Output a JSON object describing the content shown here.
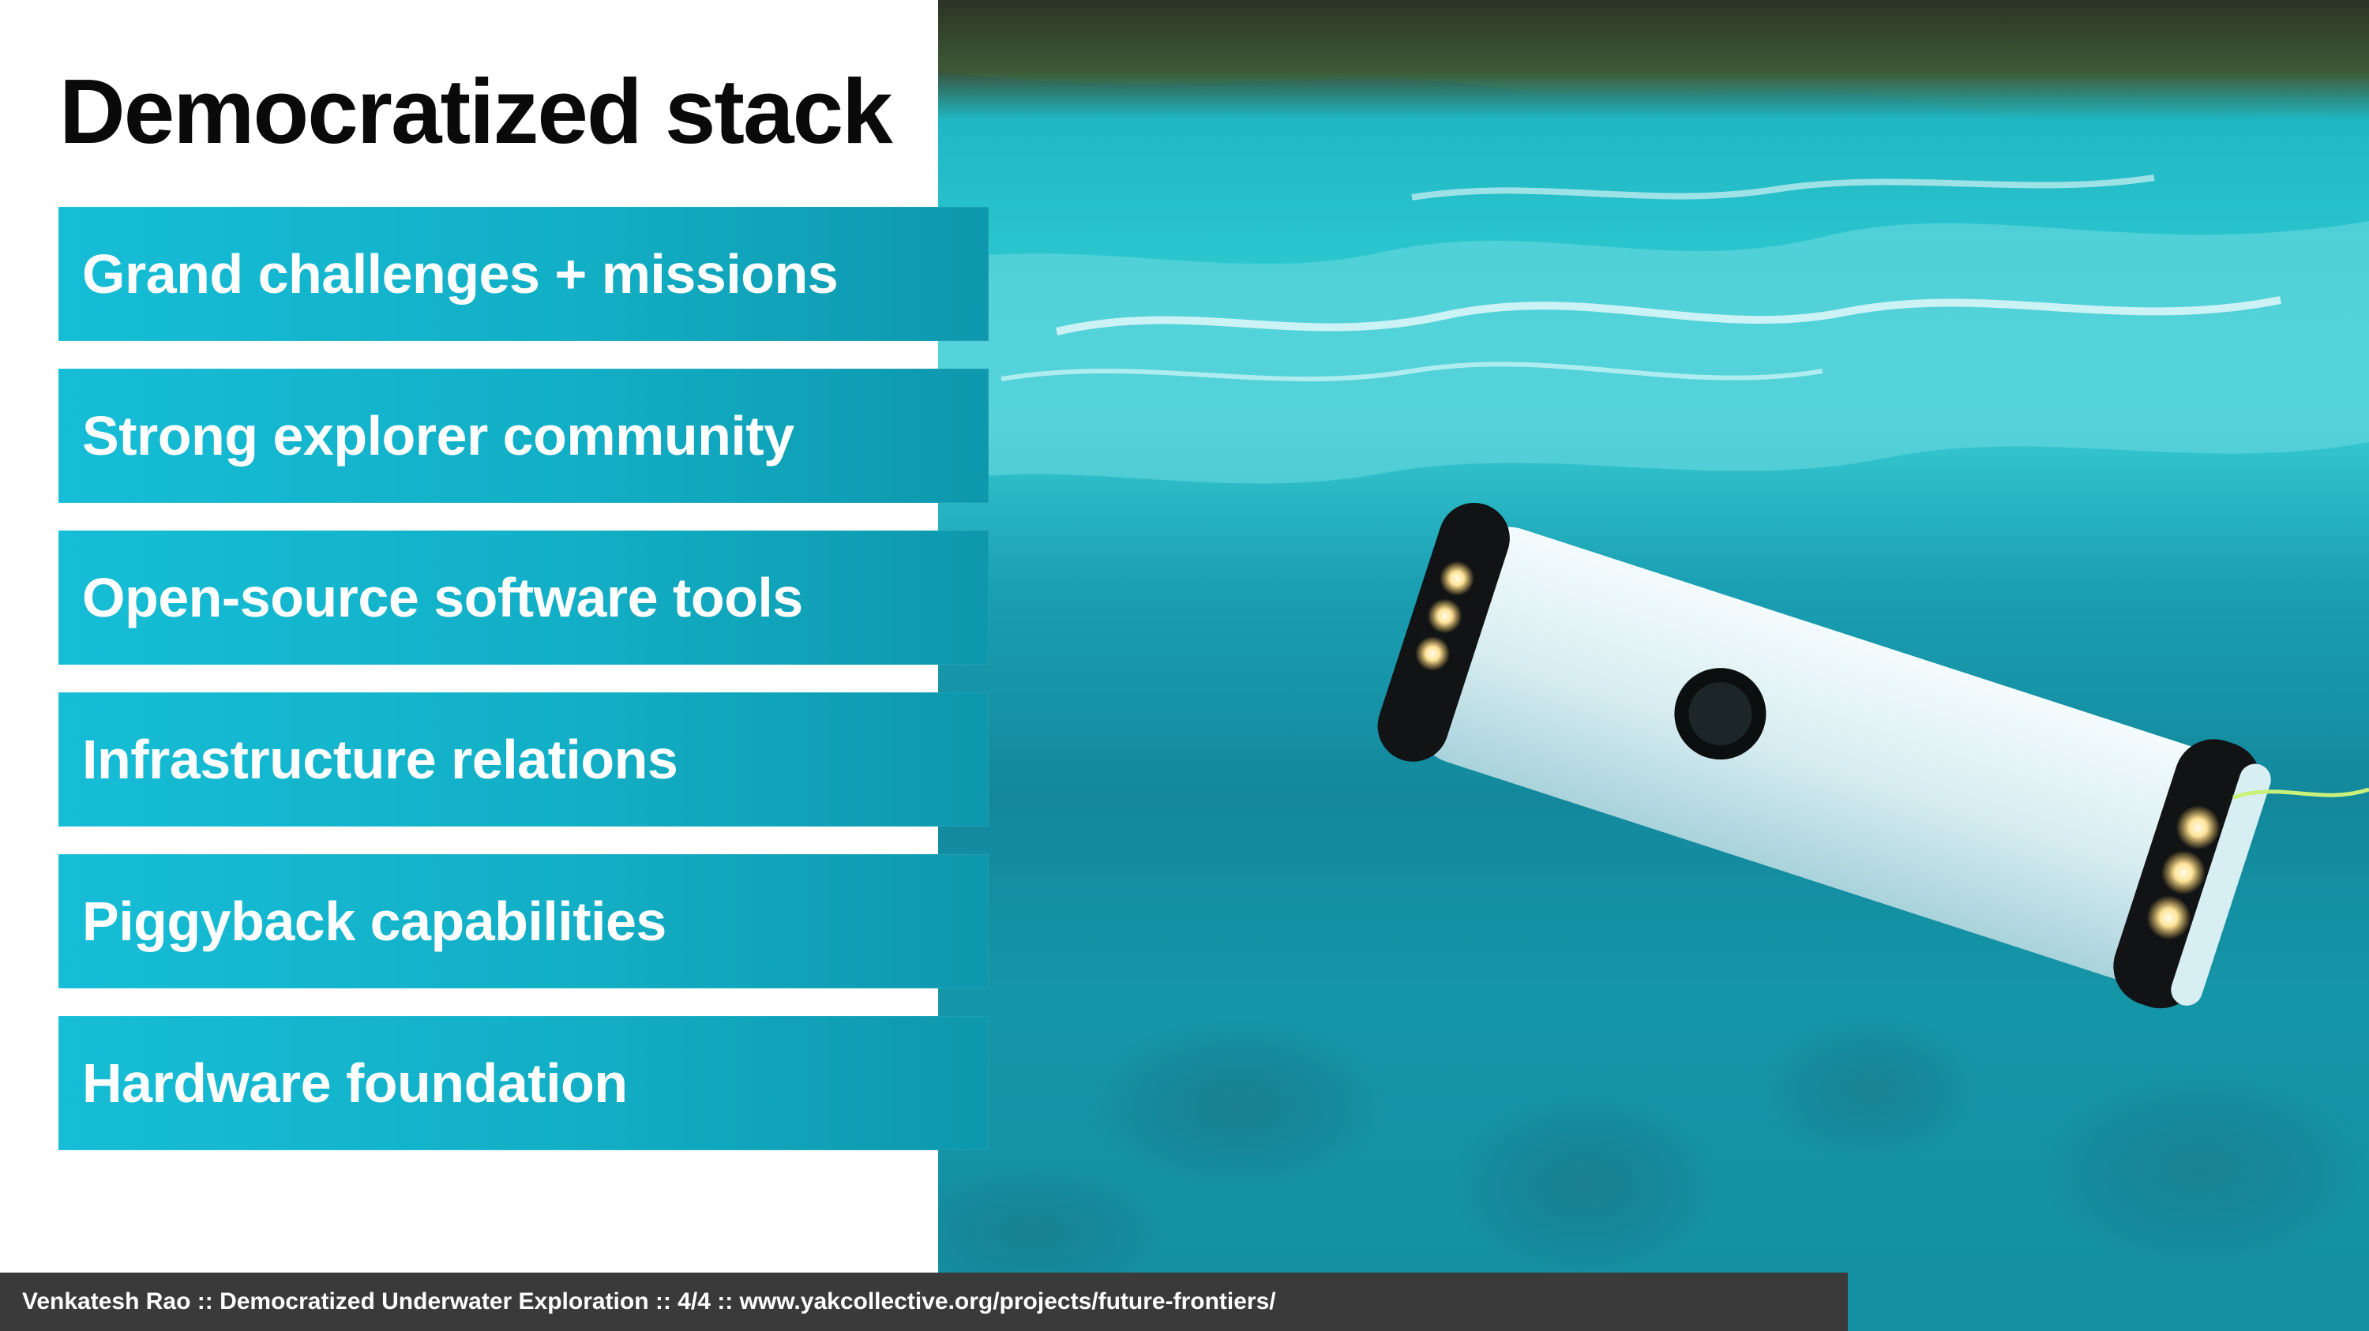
{
  "slide": {
    "title": "Democratized stack",
    "layers": [
      "Grand challenges + missions",
      "Strong explorer community",
      "Open-source software tools",
      "Infrastructure relations",
      "Piggyback capabilities",
      "Hardware foundation"
    ]
  },
  "footer": {
    "caption": "Venkatesh Rao :: Democratized Underwater Exploration :: 4/4 :: www.yakcollective.org/projects/future-frontiers/"
  },
  "colors": {
    "layer_fill": "#16bdd6",
    "footer_bg": "#3a3a3a",
    "title_text": "#0a0a0a"
  }
}
